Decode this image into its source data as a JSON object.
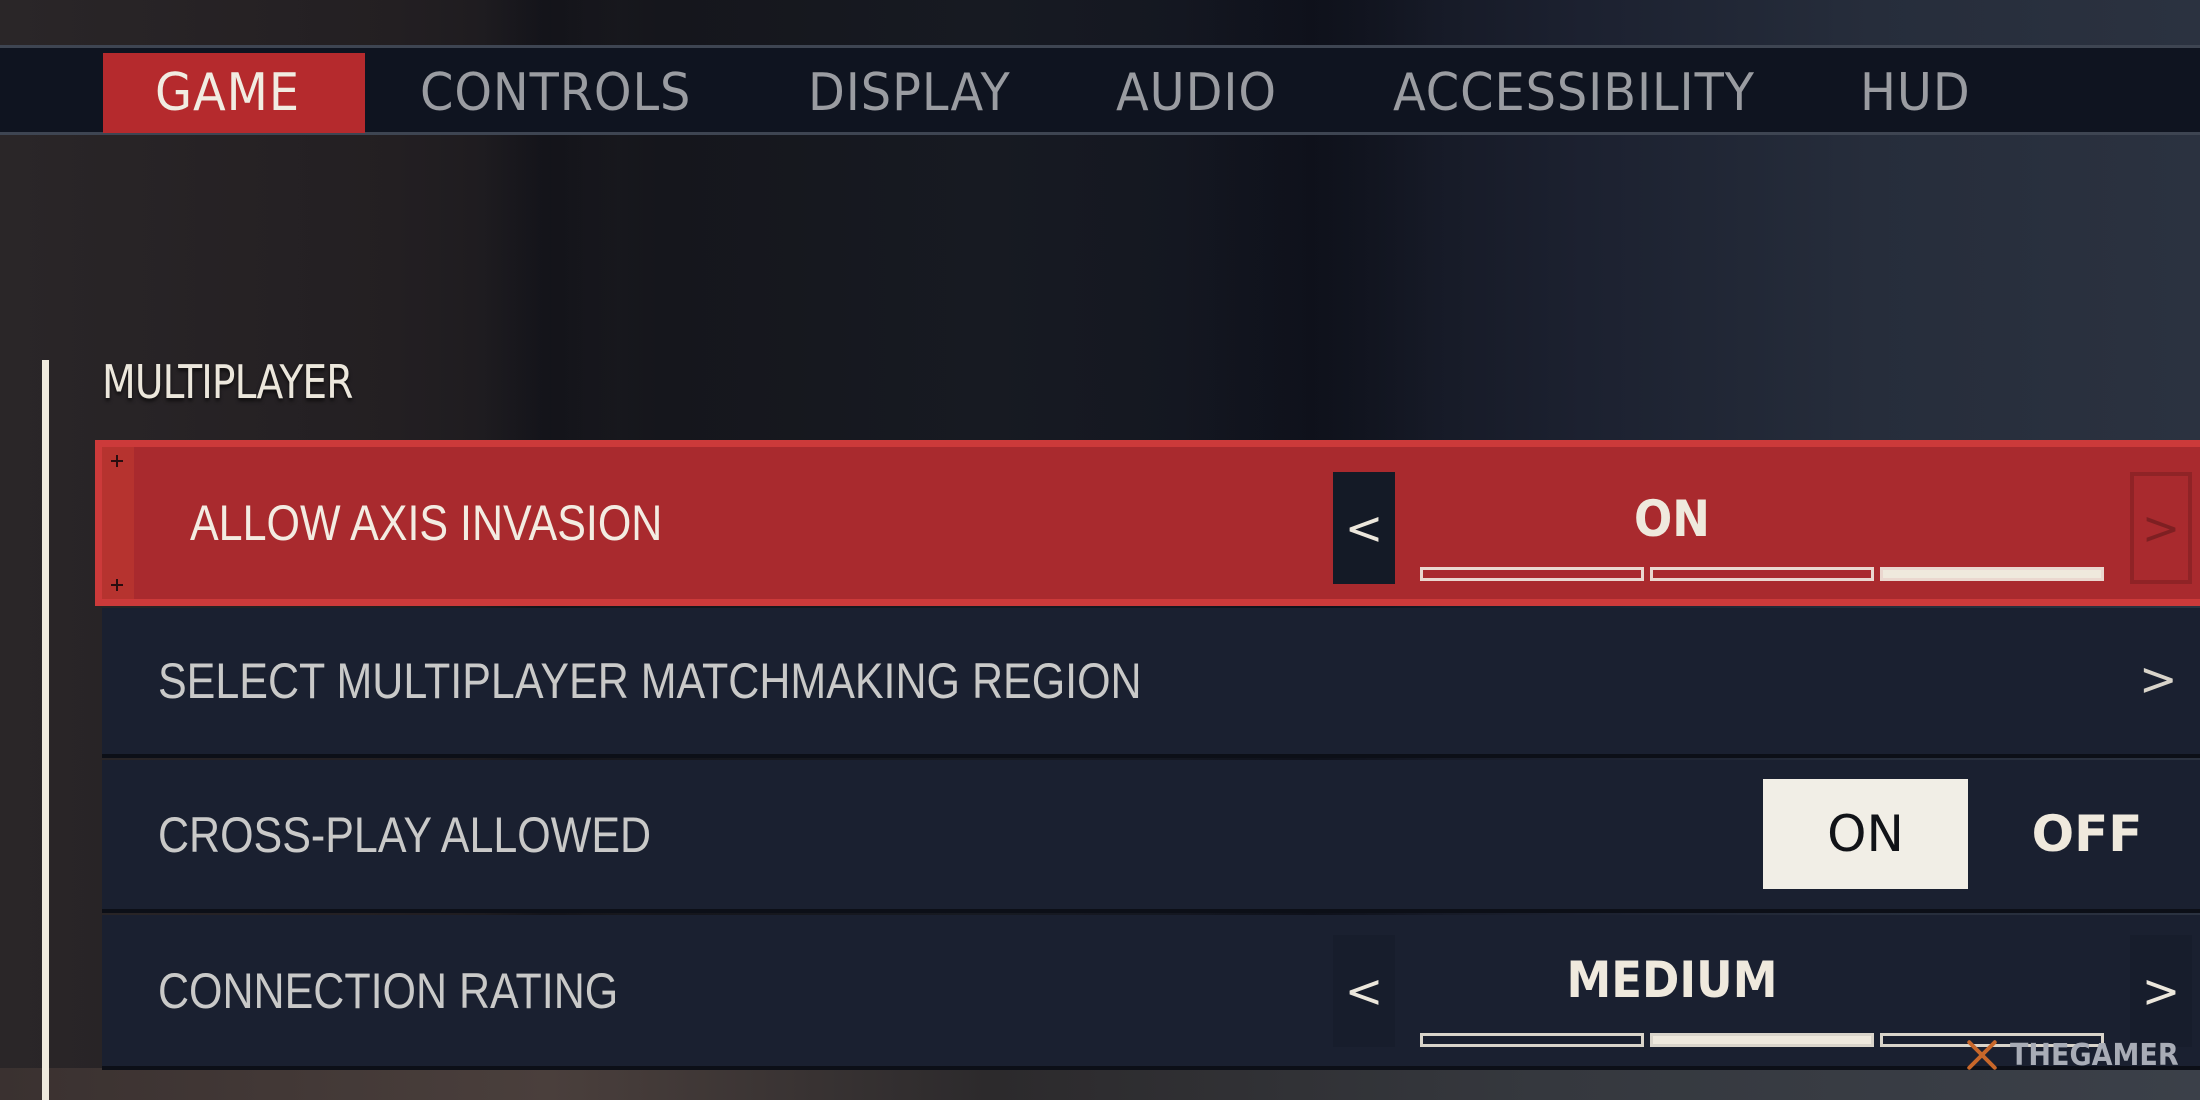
{
  "tabs": [
    {
      "label": "GAME",
      "active": true
    },
    {
      "label": "CONTROLS",
      "active": false
    },
    {
      "label": "DISPLAY",
      "active": false
    },
    {
      "label": "AUDIO",
      "active": false
    },
    {
      "label": "ACCESSIBILITY",
      "active": false
    },
    {
      "label": "HUD",
      "active": false
    }
  ],
  "section": {
    "title": "MULTIPLAYER"
  },
  "settings": [
    {
      "label": "ALLOW AXIS INVASION",
      "type": "spinner",
      "value": "ON",
      "selected": true,
      "level_index": 3,
      "level_count": 3,
      "prev_glyph": "<",
      "next_glyph": ">"
    },
    {
      "label": "SELECT MULTIPLAYER MATCHMAKING REGION",
      "type": "submenu",
      "next_glyph": ">"
    },
    {
      "label": "CROSS-PLAY ALLOWED",
      "type": "toggle",
      "on_label": "ON",
      "off_label": "OFF",
      "value": "ON"
    },
    {
      "label": "CONNECTION RATING",
      "type": "spinner",
      "value": "MEDIUM",
      "level_index": 2,
      "level_count": 3,
      "prev_glyph": "<",
      "next_glyph": ">"
    }
  ],
  "watermark": {
    "text": "THEGAMER",
    "icon": "thegamer-logo-icon"
  },
  "colors": {
    "accent_red": "#b52a2d",
    "row_bg": "#1a2030",
    "text_light": "#efe9dd"
  }
}
